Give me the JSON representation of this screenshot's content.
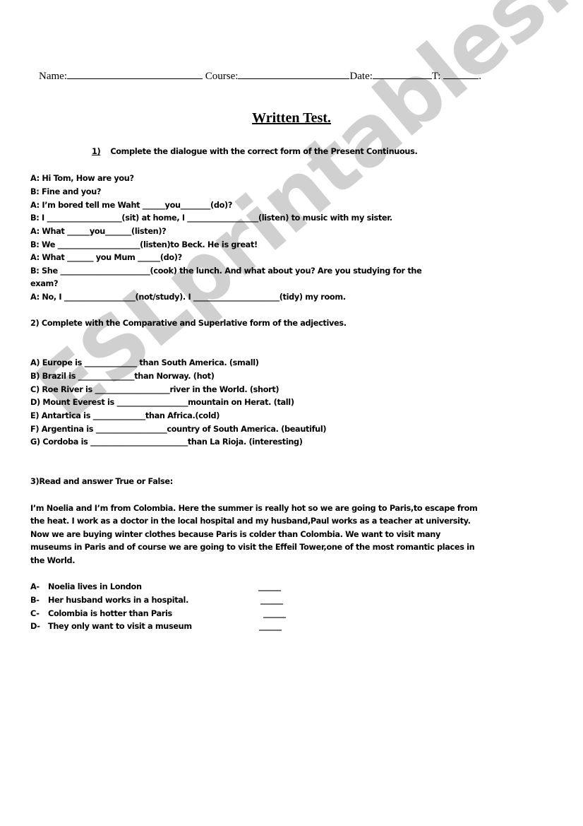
{
  "header": {
    "name_label": "Name:",
    "course_label": "Course:",
    "date_label": "Date:",
    "t_label": "T:",
    "end_mark": "."
  },
  "title": "Written Test.",
  "watermark": "ESLprintables.com",
  "section1": {
    "number": "1)",
    "instruction": "Complete the dialogue with the correct form of the Present Continuous.",
    "lines": [
      "A: Hi Tom, How are you?",
      "B: Fine and you?",
      "A: I’m bored tell me Waht ______you________(do)?",
      "B: I ____________________(sit) at home, I ___________________(listen) to music with my sister.",
      "A: What  ______you_______(listen)?",
      "B: We ______________________(listen)to Beck. He is great!",
      "A: What _______ you Mum ______(do)?",
      "B: She ________________________(cook) the lunch. And what about you? Are you studying for the",
      "exam?",
      "A: No, I ___________________(not/study). I _______________________(tidy) my room."
    ]
  },
  "section2": {
    "instruction": "2) Complete with the Comparative and Superlative form of the adjectives.",
    "items": [
      "A) Europe is ______________ than South America. (small)",
      "B) Brazil is _______________than Norway. (hot)",
      "C) Roe River is ____________________river in the World. (short)",
      "D) Mount Everest is ___________________mountain on Herat. (tall)",
      "E) Antartica is ______________than Africa.(cold)",
      "F) Argentina is ___________________country of South America. (beautiful)",
      "G) Cordoba is __________________________than La Rioja. (interesting)"
    ]
  },
  "section3": {
    "instruction": "3)Read and answer True or False:",
    "paragraph_lines": [
      "I’m Noelia and I’m from Colombia. Here the summer is really hot so we are going to Paris,to escape from",
      "the heat. I work as a doctor in the local hospital and my husband,Paul works as a teacher at university.",
      "Now we are buying winter clothes because Paris is colder than Colombia. We want to visit many",
      "museums in Paris and of course we are going to visit the Effeil Tower,one of the most romantic places in",
      "the World."
    ],
    "statements": [
      {
        "letter": "A-",
        "text": "Noelia lives in London",
        "answer": "______"
      },
      {
        "letter": "B-",
        "text": "Her husband works in a hospital.",
        "answer": "______"
      },
      {
        "letter": "C-",
        "text": "Colombia is hotter than Paris",
        "answer": "______"
      },
      {
        "letter": "D-",
        "text": "They only want to visit a museum",
        "answer": "______"
      }
    ]
  }
}
